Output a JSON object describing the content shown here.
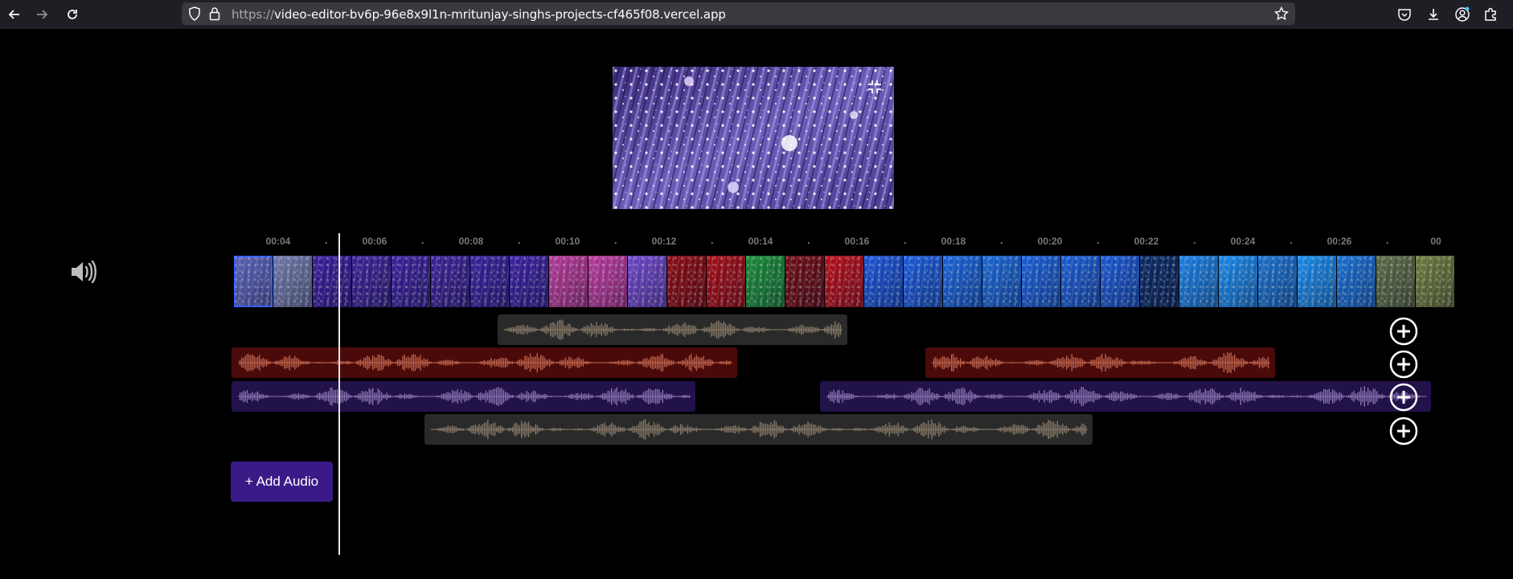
{
  "browser": {
    "url_prefix": "https://",
    "url_host": "video-editor-bv6p-96e8x9l1n-mritunjay-singhs-projects-cf465f08.vercel.app"
  },
  "timeline": {
    "ticks": [
      "00:04",
      "00:06",
      "00:08",
      "00:10",
      "00:12",
      "00:14",
      "00:16",
      "00:18",
      "00:20",
      "00:22",
      "00:24",
      "00:26",
      "00"
    ],
    "dot": "."
  },
  "filmstrip_colors": [
    "#5a61b8",
    "#6f78a8",
    "#3a1f9a",
    "#3b2397",
    "#3a229a",
    "#3b2395",
    "#37229a",
    "#3a229d",
    "#b33a97",
    "#b63a9c",
    "#6b47c6",
    "#8a0d14",
    "#a10f18",
    "#1a8a3a",
    "#6d0f18",
    "#b4101c",
    "#1b55d6",
    "#1b5ad8",
    "#1a63d8",
    "#1a66d5",
    "#1a5fd6",
    "#1b5cd2",
    "#1a58d0",
    "#0b2b66",
    "#1a7ee0",
    "#1a86e6",
    "#1a6fcc",
    "#1a88e6",
    "#1a6dd0",
    "#5a6a46",
    "#6a7a3c"
  ],
  "audio_tracks": [
    {
      "clips": [
        {
          "color": "#2a2a2a",
          "wave": "#8b7d6b"
        }
      ]
    },
    {
      "clips": [
        {
          "color": "#4a0a0a",
          "wave": "#c2684f"
        },
        {
          "color": "#4a0a0a",
          "wave": "#c2684f"
        }
      ]
    },
    {
      "clips": [
        {
          "color": "#22124a",
          "wave": "#8e78b4"
        },
        {
          "color": "#22124a",
          "wave": "#8e78b4"
        }
      ]
    },
    {
      "clips": [
        {
          "color": "#2a2a2a",
          "wave": "#8b7d6b"
        }
      ]
    }
  ],
  "add_audio_label": "+ Add Audio",
  "colors": {
    "accent": "#3a1a86",
    "playhead": "#e8e8e8"
  }
}
